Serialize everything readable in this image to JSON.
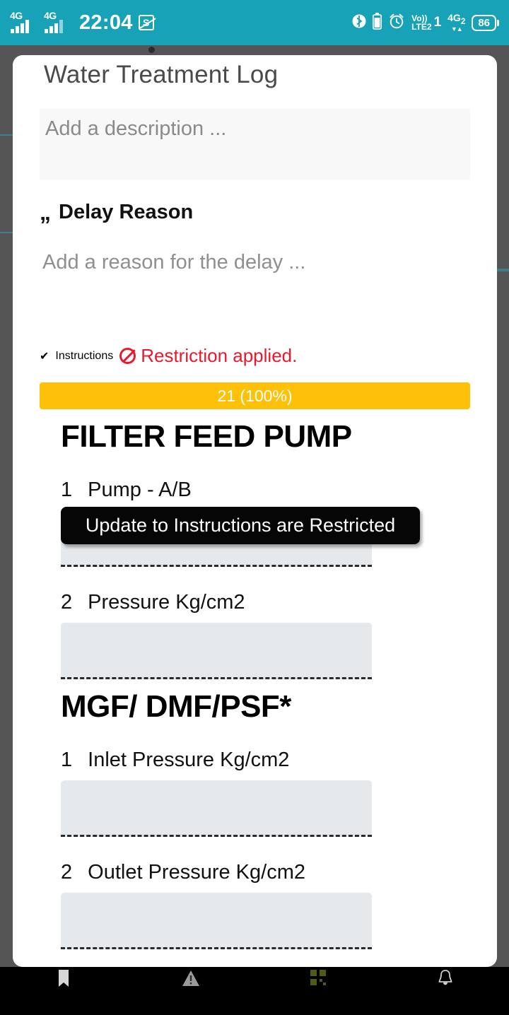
{
  "status_bar": {
    "network_label_1": "4G",
    "network_label_2": "4G",
    "time": "22:04",
    "screenshot_icon": "S",
    "bluetooth_icon": "bluetooth-icon",
    "battery_saver_icon": "battery-icon",
    "alarm_icon": "alarm-icon",
    "volte_label": "Vo))",
    "volte_sim": "1",
    "lte_label": "LTE2",
    "data_label": "4G",
    "data_sub": "2",
    "data_arrows": "▼▲",
    "battery_percent": "86"
  },
  "card": {
    "title": "Water Treatment Log",
    "description_placeholder": "Add a description ...",
    "delay_section": {
      "quote_icon": "quote-icon",
      "heading": "Delay Reason",
      "placeholder": "Add a reason for the delay ..."
    },
    "instructions_section": {
      "check_icon": "check-icon",
      "heading": "Instructions",
      "restriction_icon": "no-entry-icon",
      "restriction_text": "Restriction applied."
    },
    "progress": {
      "label": "21 (100%)",
      "percent": 100,
      "color": "#ffc107"
    },
    "groups": [
      {
        "title": "FILTER FEED PUMP",
        "items": [
          {
            "num": "1",
            "label": "Pump - A/B",
            "value": ""
          },
          {
            "num": "2",
            "label": "Pressure Kg/cm2",
            "value": ""
          }
        ]
      },
      {
        "title": "MGF/ DMF/PSF*",
        "items": [
          {
            "num": "1",
            "label": "Inlet Pressure Kg/cm2",
            "value": ""
          },
          {
            "num": "2",
            "label": "Outlet Pressure Kg/cm2",
            "value": ""
          }
        ]
      }
    ]
  },
  "tooltip": {
    "text": "Update to Instructions are Restricted"
  },
  "bottom_nav": {
    "items": [
      {
        "icon": "bookmark-icon"
      },
      {
        "icon": "warning-triangle-icon"
      },
      {
        "icon": "qr-code-icon"
      },
      {
        "icon": "bell-icon"
      }
    ]
  }
}
